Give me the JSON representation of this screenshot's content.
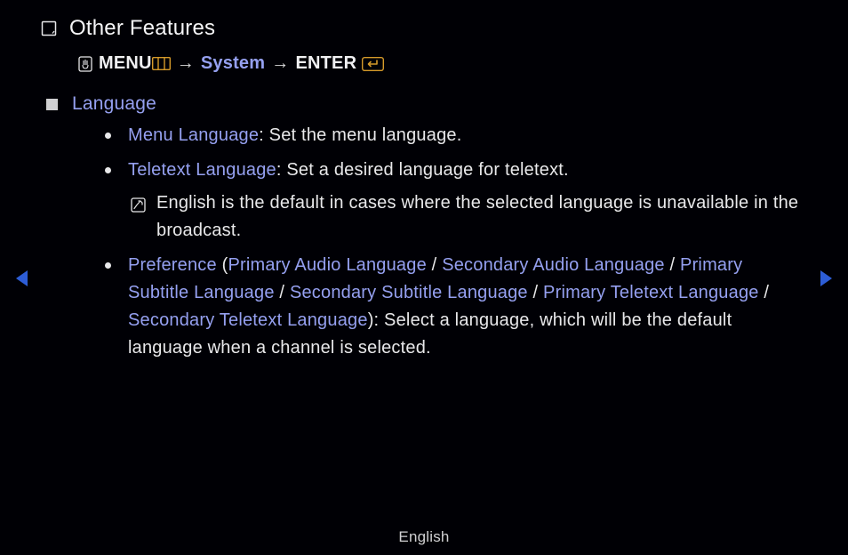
{
  "title": "Other Features",
  "breadcrumb": {
    "menu": "MENU",
    "system": "System",
    "enter": "ENTER",
    "arrow": "→"
  },
  "section": {
    "heading": "Language",
    "items": {
      "menuLang": {
        "label": "Menu Language",
        "desc": ": Set the menu language."
      },
      "teletextLang": {
        "label": "Teletext Language",
        "desc": ": Set a desired language for teletext.",
        "note": "English is the default in cases where the selected language is unavailable in the broadcast."
      },
      "preference": {
        "label": "Preference",
        "p1": "Primary Audio Language",
        "p2": "Secondary Audio Language",
        "p3": "Primary Subtitle Language",
        "p4": "Secondary Subtitle Language",
        "p5": "Primary Teletext Language",
        "p6": "Secondary Teletext Language",
        "desc": "): Select a language, which will be the default language when a channel is selected.",
        "open": " (",
        "sep": " / "
      }
    }
  },
  "footer": "English"
}
